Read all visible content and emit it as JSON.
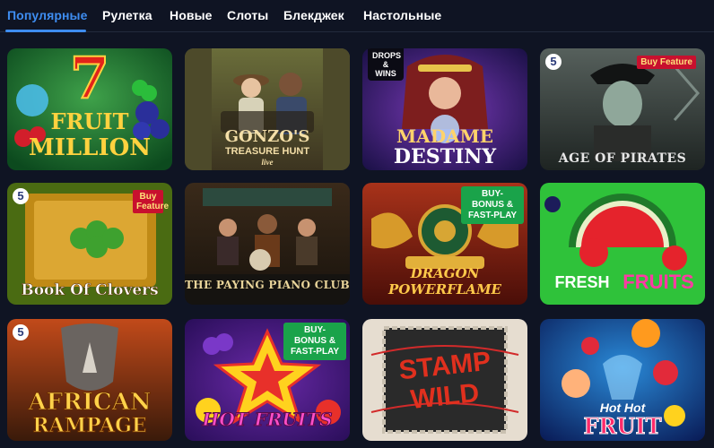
{
  "tabs": [
    {
      "label": "Популярные",
      "active": true
    },
    {
      "label": "Рулетка"
    },
    {
      "label": "Новые"
    },
    {
      "label": "Слоты"
    },
    {
      "label": "Блекджек"
    },
    {
      "label": "Настольные"
    }
  ],
  "accent_color": "#3e8df0",
  "games": [
    {
      "title_line1": "FRUIT",
      "title_line2": "MILLION",
      "logo_glyph": "7"
    },
    {
      "title_line1": "GONZO'S",
      "title_line2": "TREASURE HUNT",
      "subtitle": "live"
    },
    {
      "badge": "DROPS & WINS",
      "title_line1": "MADAME",
      "title_line2": "DESTINY"
    },
    {
      "badge": "Buy Feature",
      "title_line1": "AGE OF PIRATES",
      "s_badge": "5"
    },
    {
      "badge": "Buy Feature",
      "title_line1": "Book Of Clovers",
      "s_badge": "5"
    },
    {
      "title_line1": "THE PAYING PIANO CLUB"
    },
    {
      "badge": "BUY-BONUS & FAST-PLAY",
      "title_line1": "DRAGON",
      "title_line2": "POWERFLAME"
    },
    {
      "title_line1": "FRESH",
      "title_line2": "FRUITS"
    },
    {
      "title_line1": "AFRICAN",
      "title_line2": "RAMPAGE",
      "s_badge": "5"
    },
    {
      "badge": "BUY-BONUS & FAST-PLAY",
      "title_line1": "HOT FRUITS"
    },
    {
      "title_line1": "STAMP",
      "title_line2": "WILD"
    },
    {
      "title_line1": "Hot Hot",
      "title_line2": "FRUIT"
    }
  ]
}
